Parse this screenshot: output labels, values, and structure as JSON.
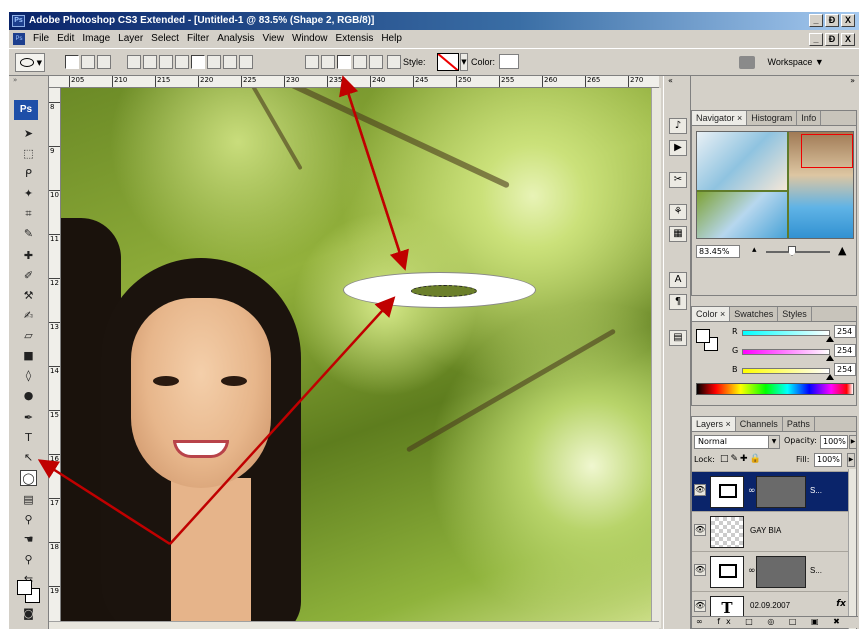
{
  "window": {
    "title": "Adobe Photoshop CS3 Extended - [Untitled-1 @ 83.5% (Shape 2, RGB/8)]",
    "app_icon": "Ps",
    "buttons": [
      "_",
      "Ɖ",
      "X"
    ]
  },
  "menu": {
    "items": [
      "File",
      "Edit",
      "Image",
      "Layer",
      "Select",
      "Filter",
      "Analysis",
      "View",
      "Window",
      "Extensis",
      "Help"
    ]
  },
  "options_bar": {
    "style_label": "Style:",
    "color_label": "Color:",
    "workspace_label": "Workspace ▼"
  },
  "ruler": {
    "top_ticks": [
      "205",
      "210",
      "215",
      "220",
      "225",
      "230",
      "235",
      "240",
      "245",
      "250",
      "255",
      "260",
      "265",
      "270"
    ],
    "left_ticks": [
      "8",
      "9",
      "10",
      "11",
      "12",
      "13",
      "14",
      "15",
      "16",
      "17",
      "18",
      "19"
    ]
  },
  "toolbox": {
    "logo": "Ps"
  },
  "navigator": {
    "tabs": [
      "Navigator ×",
      "Histogram",
      "Info"
    ],
    "zoom": "83.45%"
  },
  "color_panel": {
    "tabs": [
      "Color ×",
      "Swatches",
      "Styles"
    ],
    "channels": [
      {
        "label": "R",
        "value": "254",
        "gradient": "linear-gradient(to right,#00ffff,#ffffff)"
      },
      {
        "label": "G",
        "value": "254",
        "gradient": "linear-gradient(to right,#ff00ff,#ffffff)"
      },
      {
        "label": "B",
        "value": "254",
        "gradient": "linear-gradient(to right,#ffff00,#ffffff)"
      }
    ]
  },
  "layers_panel": {
    "tabs": [
      "Layers ×",
      "Channels",
      "Paths"
    ],
    "blend_mode": "Normal",
    "opacity_label": "Opacity:",
    "opacity": "100%",
    "lock_label": "Lock:",
    "fill_label": "Fill:",
    "fill": "100%",
    "layers": [
      {
        "name": "S...",
        "selected": true
      },
      {
        "name": "GAY BIA",
        "selected": false
      },
      {
        "name": "S...",
        "selected": false
      },
      {
        "name": "02.09.2007",
        "selected": false
      }
    ],
    "footer": "∞ fx □ ◎ □ ▣ ✖"
  }
}
